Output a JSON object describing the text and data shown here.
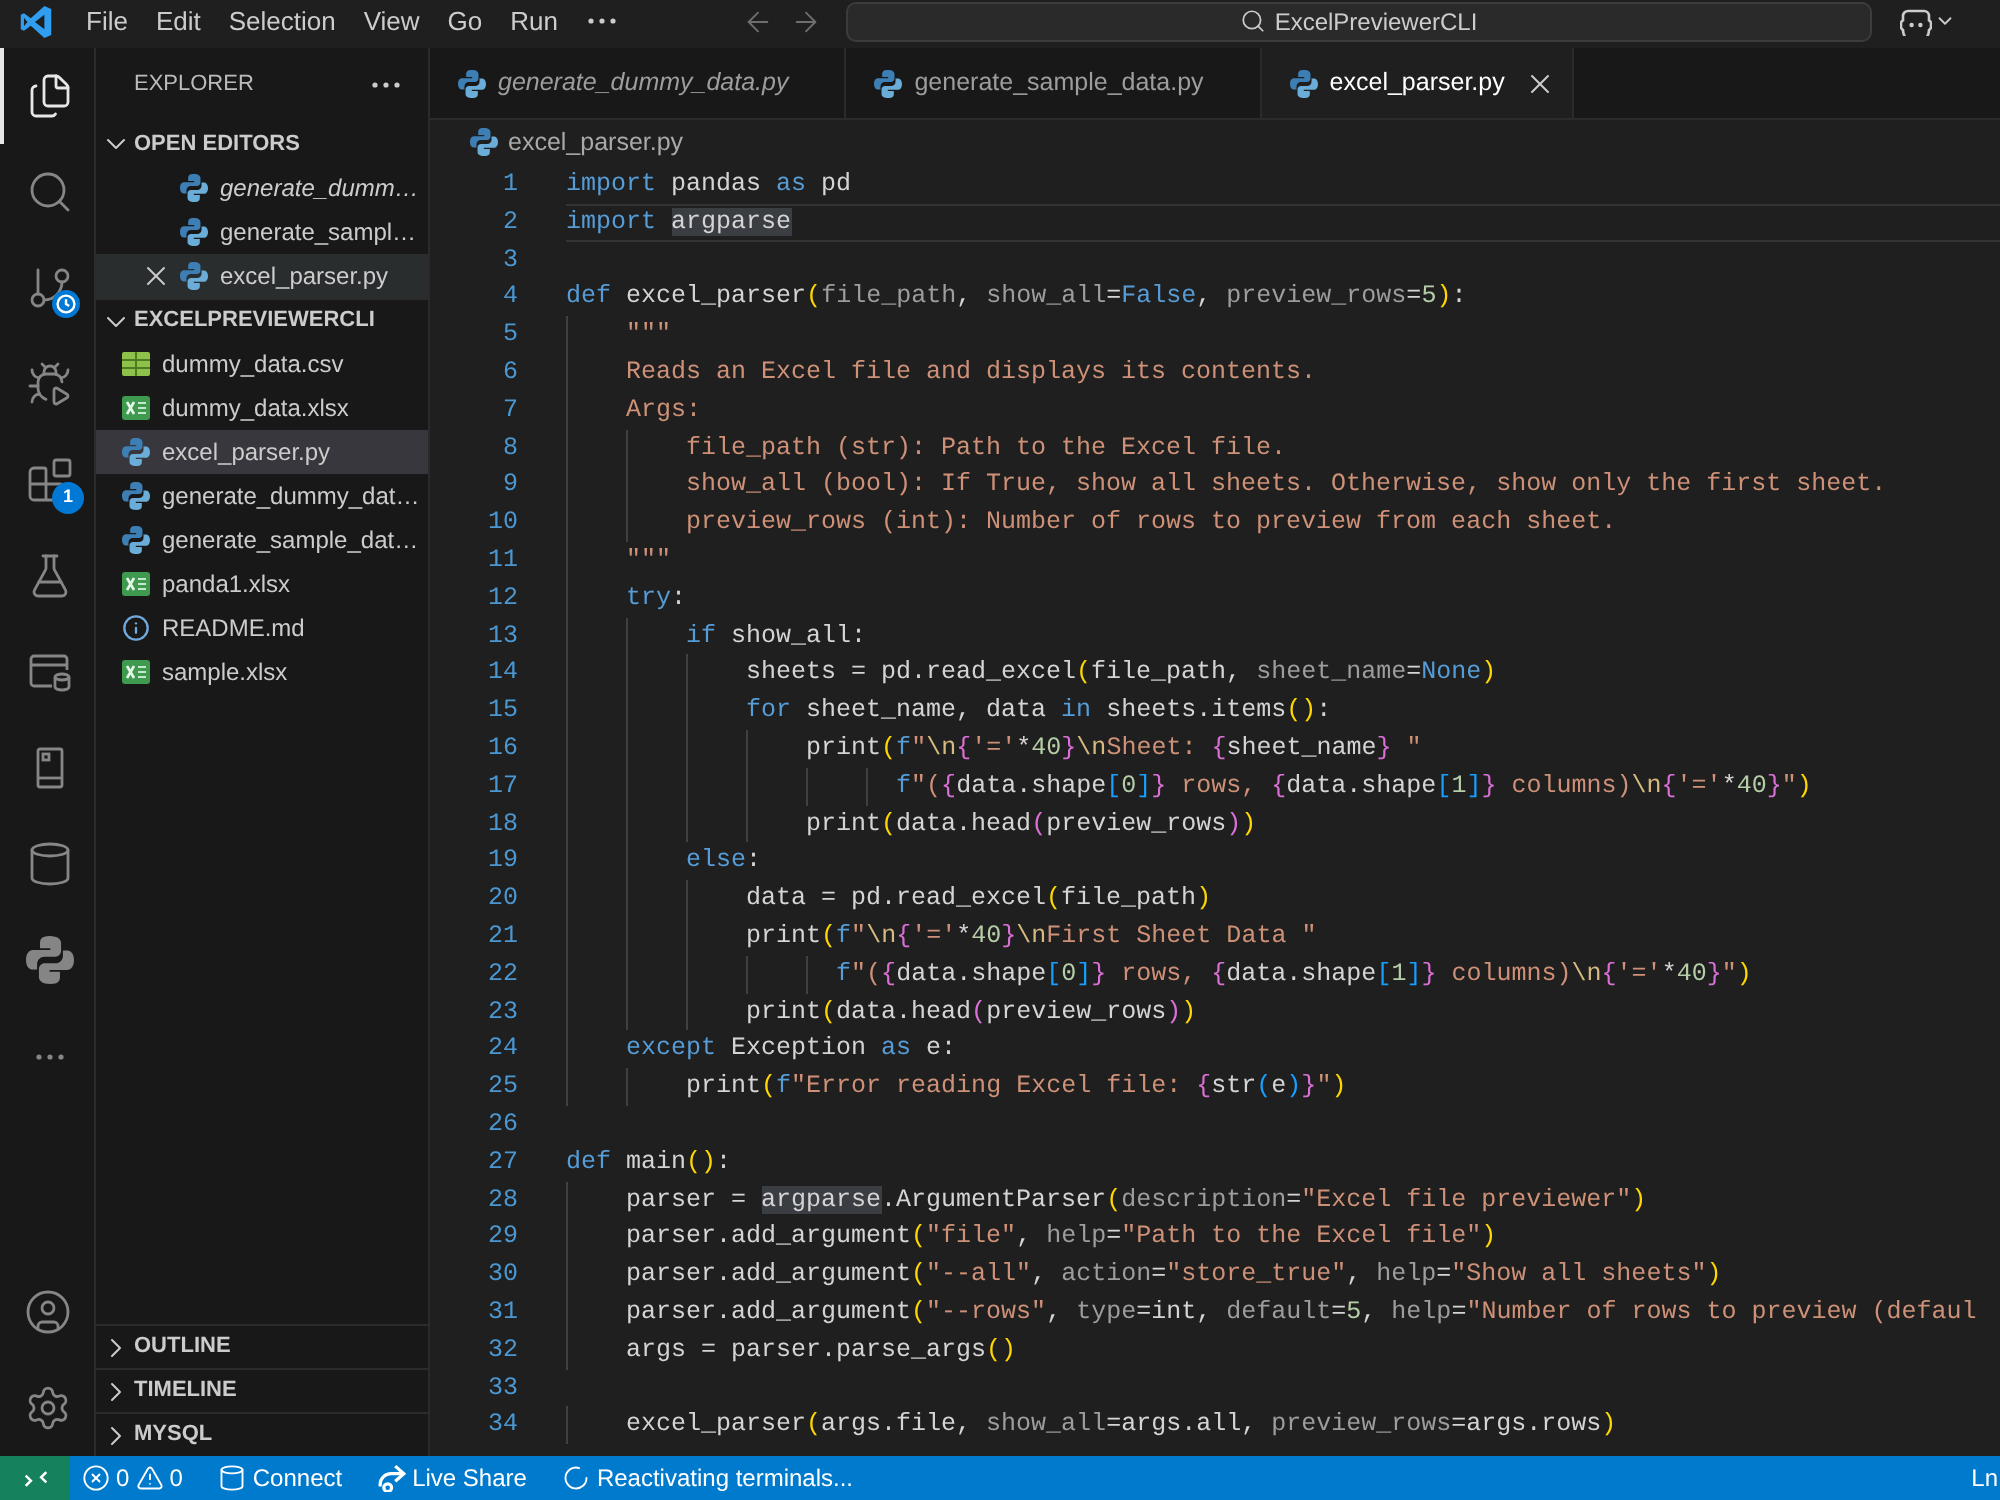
{
  "title_bar": {
    "menu": [
      "File",
      "Edit",
      "Selection",
      "View",
      "Go",
      "Run"
    ],
    "command_center": "ExcelPreviewerCLI"
  },
  "activity_bar": {
    "items": [
      {
        "kind": "explorer",
        "selected": true
      },
      {
        "kind": "search",
        "selected": false
      },
      {
        "kind": "source-control",
        "selected": false
      },
      {
        "kind": "run-debug",
        "selected": false
      },
      {
        "kind": "extensions",
        "selected": false,
        "badge": "1"
      },
      {
        "kind": "testing",
        "selected": false
      },
      {
        "kind": "remote",
        "selected": false
      },
      {
        "kind": "device",
        "selected": false
      },
      {
        "kind": "database",
        "selected": false
      },
      {
        "kind": "python",
        "selected": false
      },
      {
        "kind": "more",
        "selected": false
      }
    ],
    "bottom": [
      {
        "kind": "account"
      },
      {
        "kind": "settings"
      }
    ]
  },
  "explorer": {
    "title": "EXPLORER",
    "open_editors": {
      "label": "OPEN EDITORS",
      "expanded": true,
      "items": [
        {
          "name": "generate_dumm…",
          "preview": true,
          "selected": false
        },
        {
          "name": "generate_sampl…",
          "preview": false,
          "selected": false
        },
        {
          "name": "excel_parser.py",
          "preview": false,
          "selected": true
        }
      ]
    },
    "project": {
      "label": "EXCELPREVIEWERCLI",
      "expanded": true,
      "files": [
        {
          "name": "dummy_data.csv",
          "kind": "csv",
          "selected": false
        },
        {
          "name": "dummy_data.xlsx",
          "kind": "excel",
          "selected": false
        },
        {
          "name": "excel_parser.py",
          "kind": "python",
          "selected": true
        },
        {
          "name": "generate_dummy_dat…",
          "kind": "python",
          "selected": false
        },
        {
          "name": "generate_sample_dat…",
          "kind": "python",
          "selected": false
        },
        {
          "name": "panda1.xlsx",
          "kind": "excel",
          "selected": false
        },
        {
          "name": "README.md",
          "kind": "info",
          "selected": false
        },
        {
          "name": "sample.xlsx",
          "kind": "excel",
          "selected": false
        }
      ]
    },
    "panels": [
      {
        "label": "OUTLINE",
        "expanded": false
      },
      {
        "label": "TIMELINE",
        "expanded": false
      },
      {
        "label": "MYSQL",
        "expanded": false
      }
    ]
  },
  "tabs": [
    {
      "label": "generate_dummy_data.py",
      "preview": true,
      "selected": false
    },
    {
      "label": "generate_sample_data.py",
      "preview": false,
      "selected": false
    },
    {
      "label": "excel_parser.py",
      "preview": false,
      "selected": true
    }
  ],
  "editor": {
    "breadcrumb": "excel_parser.py",
    "lines": [
      {
        "number": "1",
        "current": false,
        "tokens": [
          {
            "text": "import",
            "kind": "keyword"
          },
          {
            "text": " pandas ",
            "kind": "name"
          },
          {
            "text": "as",
            "kind": "keyword"
          },
          {
            "text": " pd",
            "kind": "name"
          }
        ]
      },
      {
        "number": "2",
        "current": true,
        "tokens": [
          {
            "text": "import ",
            "kind": "keyword"
          },
          {
            "text": "argparse",
            "kind": "highlight"
          }
        ]
      },
      {
        "number": "3",
        "current": false
      },
      {
        "number": "4",
        "current": false,
        "tokens": [
          {
            "text": "def",
            "kind": "keyword"
          },
          {
            "text": " excel_parser",
            "kind": "name"
          },
          {
            "text": "(",
            "kind": "bracket1"
          },
          {
            "text": "file_path",
            "kind": "parameter"
          },
          {
            "text": ", ",
            "kind": "name"
          },
          {
            "text": "show_all",
            "kind": "parameter"
          },
          {
            "text": "=",
            "kind": "name"
          },
          {
            "text": "False",
            "kind": "constant"
          },
          {
            "text": ", ",
            "kind": "name"
          },
          {
            "text": "preview_rows",
            "kind": "parameter"
          },
          {
            "text": "=",
            "kind": "name"
          },
          {
            "text": "5",
            "kind": "number"
          },
          {
            "text": ")",
            "kind": "bracket1"
          },
          {
            "text": ":",
            "kind": "name"
          }
        ]
      },
      {
        "number": "5",
        "current": false,
        "tokens": [
          {
            "text": "    \"\"\"",
            "kind": "string"
          }
        ]
      },
      {
        "number": "6",
        "current": false,
        "tokens": [
          {
            "text": "    Reads an Excel file and displays its contents.",
            "kind": "string"
          }
        ]
      },
      {
        "number": "7",
        "current": false,
        "tokens": [
          {
            "text": "    Args:",
            "kind": "string"
          }
        ]
      },
      {
        "number": "8",
        "current": false,
        "tokens": [
          {
            "text": "        file_path (str): Path to the Excel file.",
            "kind": "string"
          }
        ]
      },
      {
        "number": "9",
        "current": false,
        "tokens": [
          {
            "text": "        show_all (bool): If True, show all sheets. Otherwise, show only the first sheet.",
            "kind": "string"
          }
        ]
      },
      {
        "number": "10",
        "current": false,
        "tokens": [
          {
            "text": "        preview_rows (int): Number of rows to preview from each sheet.",
            "kind": "string"
          }
        ]
      },
      {
        "number": "11",
        "current": false,
        "tokens": [
          {
            "text": "    \"\"\"",
            "kind": "string"
          }
        ]
      },
      {
        "number": "12",
        "current": false,
        "tokens": [
          {
            "text": "    try",
            "kind": "keyword"
          },
          {
            "text": ":",
            "kind": "name"
          }
        ]
      },
      {
        "number": "13",
        "current": false,
        "tokens": [
          {
            "text": "        if",
            "kind": "keyword"
          },
          {
            "text": " show_all:",
            "kind": "name"
          }
        ]
      },
      {
        "number": "14",
        "current": false,
        "tokens": [
          {
            "text": "            sheets = pd.read_excel",
            "kind": "name"
          },
          {
            "text": "(",
            "kind": "bracket1"
          },
          {
            "text": "file_path, ",
            "kind": "name"
          },
          {
            "text": "sheet_name",
            "kind": "parameter"
          },
          {
            "text": "=",
            "kind": "name"
          },
          {
            "text": "None",
            "kind": "constant"
          },
          {
            "text": ")",
            "kind": "bracket1"
          }
        ]
      },
      {
        "number": "15",
        "current": false,
        "tokens": [
          {
            "text": "            for",
            "kind": "keyword"
          },
          {
            "text": " sheet_name, data ",
            "kind": "name"
          },
          {
            "text": "in",
            "kind": "keyword"
          },
          {
            "text": " sheets.items",
            "kind": "name"
          },
          {
            "text": "()",
            "kind": "bracket1"
          },
          {
            "text": ":",
            "kind": "name"
          }
        ]
      },
      {
        "number": "16",
        "current": false,
        "tokens": [
          {
            "text": "                print",
            "kind": "name"
          },
          {
            "text": "(",
            "kind": "bracket1"
          },
          {
            "text": "f",
            "kind": "keyword"
          },
          {
            "text": "\"",
            "kind": "string"
          },
          {
            "text": "\\n",
            "kind": "escape"
          },
          {
            "text": "{",
            "kind": "bracket2"
          },
          {
            "text": "'='",
            "kind": "string"
          },
          {
            "text": "*",
            "kind": "name"
          },
          {
            "text": "40",
            "kind": "number"
          },
          {
            "text": "}",
            "kind": "bracket2"
          },
          {
            "text": "\\n",
            "kind": "escape"
          },
          {
            "text": "Sheet: ",
            "kind": "string"
          },
          {
            "text": "{",
            "kind": "bracket2"
          },
          {
            "text": "sheet_name",
            "kind": "name"
          },
          {
            "text": "}",
            "kind": "bracket2"
          },
          {
            "text": " \"",
            "kind": "string"
          }
        ]
      },
      {
        "number": "17",
        "current": false,
        "tokens": [
          {
            "text": "                      f",
            "kind": "keyword"
          },
          {
            "text": "\"(",
            "kind": "string"
          },
          {
            "text": "{",
            "kind": "bracket2"
          },
          {
            "text": "data.shape",
            "kind": "name"
          },
          {
            "text": "[",
            "kind": "bracket3"
          },
          {
            "text": "0",
            "kind": "number"
          },
          {
            "text": "]",
            "kind": "bracket3"
          },
          {
            "text": "}",
            "kind": "bracket2"
          },
          {
            "text": " rows, ",
            "kind": "string"
          },
          {
            "text": "{",
            "kind": "bracket2"
          },
          {
            "text": "data.shape",
            "kind": "name"
          },
          {
            "text": "[",
            "kind": "bracket3"
          },
          {
            "text": "1",
            "kind": "number"
          },
          {
            "text": "]",
            "kind": "bracket3"
          },
          {
            "text": "}",
            "kind": "bracket2"
          },
          {
            "text": " columns)",
            "kind": "string"
          },
          {
            "text": "\\n",
            "kind": "escape"
          },
          {
            "text": "{",
            "kind": "bracket2"
          },
          {
            "text": "'='",
            "kind": "string"
          },
          {
            "text": "*",
            "kind": "name"
          },
          {
            "text": "40",
            "kind": "number"
          },
          {
            "text": "}",
            "kind": "bracket2"
          },
          {
            "text": "\"",
            "kind": "string"
          },
          {
            "text": ")",
            "kind": "bracket1"
          }
        ]
      },
      {
        "number": "18",
        "current": false,
        "tokens": [
          {
            "text": "                print",
            "kind": "name"
          },
          {
            "text": "(",
            "kind": "bracket1"
          },
          {
            "text": "data.head",
            "kind": "name"
          },
          {
            "text": "(",
            "kind": "bracket2"
          },
          {
            "text": "preview_rows",
            "kind": "name"
          },
          {
            "text": ")",
            "kind": "bracket2"
          },
          {
            "text": ")",
            "kind": "bracket1"
          }
        ]
      },
      {
        "number": "19",
        "current": false,
        "tokens": [
          {
            "text": "        else",
            "kind": "keyword"
          },
          {
            "text": ":",
            "kind": "name"
          }
        ]
      },
      {
        "number": "20",
        "current": false,
        "tokens": [
          {
            "text": "            data = pd.read_excel",
            "kind": "name"
          },
          {
            "text": "(",
            "kind": "bracket1"
          },
          {
            "text": "file_path",
            "kind": "name"
          },
          {
            "text": ")",
            "kind": "bracket1"
          }
        ]
      },
      {
        "number": "21",
        "current": false,
        "tokens": [
          {
            "text": "            print",
            "kind": "name"
          },
          {
            "text": "(",
            "kind": "bracket1"
          },
          {
            "text": "f",
            "kind": "keyword"
          },
          {
            "text": "\"",
            "kind": "string"
          },
          {
            "text": "\\n",
            "kind": "escape"
          },
          {
            "text": "{",
            "kind": "bracket2"
          },
          {
            "text": "'='",
            "kind": "string"
          },
          {
            "text": "*",
            "kind": "name"
          },
          {
            "text": "40",
            "kind": "number"
          },
          {
            "text": "}",
            "kind": "bracket2"
          },
          {
            "text": "\\n",
            "kind": "escape"
          },
          {
            "text": "First Sheet Data \"",
            "kind": "string"
          }
        ]
      },
      {
        "number": "22",
        "current": false,
        "tokens": [
          {
            "text": "                  f",
            "kind": "keyword"
          },
          {
            "text": "\"(",
            "kind": "string"
          },
          {
            "text": "{",
            "kind": "bracket2"
          },
          {
            "text": "data.shape",
            "kind": "name"
          },
          {
            "text": "[",
            "kind": "bracket3"
          },
          {
            "text": "0",
            "kind": "number"
          },
          {
            "text": "]",
            "kind": "bracket3"
          },
          {
            "text": "}",
            "kind": "bracket2"
          },
          {
            "text": " rows, ",
            "kind": "string"
          },
          {
            "text": "{",
            "kind": "bracket2"
          },
          {
            "text": "data.shape",
            "kind": "name"
          },
          {
            "text": "[",
            "kind": "bracket3"
          },
          {
            "text": "1",
            "kind": "number"
          },
          {
            "text": "]",
            "kind": "bracket3"
          },
          {
            "text": "}",
            "kind": "bracket2"
          },
          {
            "text": " columns)",
            "kind": "string"
          },
          {
            "text": "\\n",
            "kind": "escape"
          },
          {
            "text": "{",
            "kind": "bracket2"
          },
          {
            "text": "'='",
            "kind": "string"
          },
          {
            "text": "*",
            "kind": "name"
          },
          {
            "text": "40",
            "kind": "number"
          },
          {
            "text": "}",
            "kind": "bracket2"
          },
          {
            "text": "\"",
            "kind": "string"
          },
          {
            "text": ")",
            "kind": "bracket1"
          }
        ]
      },
      {
        "number": "23",
        "current": false,
        "tokens": [
          {
            "text": "            print",
            "kind": "name"
          },
          {
            "text": "(",
            "kind": "bracket1"
          },
          {
            "text": "data.head",
            "kind": "name"
          },
          {
            "text": "(",
            "kind": "bracket2"
          },
          {
            "text": "preview_rows",
            "kind": "name"
          },
          {
            "text": ")",
            "kind": "bracket2"
          },
          {
            "text": ")",
            "kind": "bracket1"
          }
        ]
      },
      {
        "number": "24",
        "current": false,
        "tokens": [
          {
            "text": "    except",
            "kind": "keyword"
          },
          {
            "text": " Exception ",
            "kind": "name"
          },
          {
            "text": "as",
            "kind": "keyword"
          },
          {
            "text": " e:",
            "kind": "name"
          }
        ]
      },
      {
        "number": "25",
        "current": false,
        "tokens": [
          {
            "text": "        print",
            "kind": "name"
          },
          {
            "text": "(",
            "kind": "bracket1"
          },
          {
            "text": "f",
            "kind": "keyword"
          },
          {
            "text": "\"Error reading Excel file: ",
            "kind": "string"
          },
          {
            "text": "{",
            "kind": "bracket2"
          },
          {
            "text": "str",
            "kind": "name"
          },
          {
            "text": "(",
            "kind": "bracket3"
          },
          {
            "text": "e",
            "kind": "name"
          },
          {
            "text": ")",
            "kind": "bracket3"
          },
          {
            "text": "}",
            "kind": "bracket2"
          },
          {
            "text": "\"",
            "kind": "string"
          },
          {
            "text": ")",
            "kind": "bracket1"
          }
        ]
      },
      {
        "number": "26",
        "current": false
      },
      {
        "number": "27",
        "current": false,
        "tokens": [
          {
            "text": "def",
            "kind": "keyword"
          },
          {
            "text": " main",
            "kind": "name"
          },
          {
            "text": "()",
            "kind": "bracket1"
          },
          {
            "text": ":",
            "kind": "name"
          }
        ]
      },
      {
        "number": "28",
        "current": false,
        "tokens": [
          {
            "text": "    parser = ",
            "kind": "name"
          },
          {
            "text": "argparse",
            "kind": "highlight"
          },
          {
            "text": ".ArgumentParser",
            "kind": "name"
          },
          {
            "text": "(",
            "kind": "bracket1"
          },
          {
            "text": "description",
            "kind": "parameter"
          },
          {
            "text": "=",
            "kind": "name"
          },
          {
            "text": "\"Excel file previewer\"",
            "kind": "string"
          },
          {
            "text": ")",
            "kind": "bracket1"
          }
        ]
      },
      {
        "number": "29",
        "current": false,
        "tokens": [
          {
            "text": "    parser.add_argument",
            "kind": "name"
          },
          {
            "text": "(",
            "kind": "bracket1"
          },
          {
            "text": "\"file\"",
            "kind": "string"
          },
          {
            "text": ", ",
            "kind": "name"
          },
          {
            "text": "help",
            "kind": "parameter"
          },
          {
            "text": "=",
            "kind": "name"
          },
          {
            "text": "\"Path to the Excel file\"",
            "kind": "string"
          },
          {
            "text": ")",
            "kind": "bracket1"
          }
        ]
      },
      {
        "number": "30",
        "current": false,
        "tokens": [
          {
            "text": "    parser.add_argument",
            "kind": "name"
          },
          {
            "text": "(",
            "kind": "bracket1"
          },
          {
            "text": "\"--all\"",
            "kind": "string"
          },
          {
            "text": ", ",
            "kind": "name"
          },
          {
            "text": "action",
            "kind": "parameter"
          },
          {
            "text": "=",
            "kind": "name"
          },
          {
            "text": "\"store_true\"",
            "kind": "string"
          },
          {
            "text": ", ",
            "kind": "name"
          },
          {
            "text": "help",
            "kind": "parameter"
          },
          {
            "text": "=",
            "kind": "name"
          },
          {
            "text": "\"Show all sheets\"",
            "kind": "string"
          },
          {
            "text": ")",
            "kind": "bracket1"
          }
        ]
      },
      {
        "number": "31",
        "current": false,
        "tokens": [
          {
            "text": "    parser.add_argument",
            "kind": "name"
          },
          {
            "text": "(",
            "kind": "bracket1"
          },
          {
            "text": "\"--rows\"",
            "kind": "string"
          },
          {
            "text": ", ",
            "kind": "name"
          },
          {
            "text": "type",
            "kind": "parameter"
          },
          {
            "text": "=int, ",
            "kind": "name"
          },
          {
            "text": "default",
            "kind": "parameter"
          },
          {
            "text": "=",
            "kind": "name"
          },
          {
            "text": "5",
            "kind": "number"
          },
          {
            "text": ", ",
            "kind": "name"
          },
          {
            "text": "help",
            "kind": "parameter"
          },
          {
            "text": "=",
            "kind": "name"
          },
          {
            "text": "\"Number of rows to preview (defaul",
            "kind": "string"
          }
        ]
      },
      {
        "number": "32",
        "current": false,
        "tokens": [
          {
            "text": "    args = parser.parse_args",
            "kind": "name"
          },
          {
            "text": "()",
            "kind": "bracket1"
          }
        ]
      },
      {
        "number": "33",
        "current": false
      },
      {
        "number": "34",
        "current": false,
        "tokens": [
          {
            "text": "    excel_parser",
            "kind": "name"
          },
          {
            "text": "(",
            "kind": "bracket1"
          },
          {
            "text": "args.file, ",
            "kind": "name"
          },
          {
            "text": "show_all",
            "kind": "parameter"
          },
          {
            "text": "=args.all, ",
            "kind": "name"
          },
          {
            "text": "preview_rows",
            "kind": "parameter"
          },
          {
            "text": "=args.rows",
            "kind": "name"
          },
          {
            "text": ")",
            "kind": "bracket1"
          }
        ]
      }
    ]
  },
  "status_bar": {
    "items": [
      {
        "kind": "errors",
        "label": "0"
      },
      {
        "kind": "warnings",
        "label": "0"
      },
      {
        "kind": "connect",
        "label": "Connect"
      },
      {
        "kind": "live-share",
        "label": "Live Share"
      },
      {
        "kind": "progress",
        "label": "Reactivating terminals..."
      },
      {
        "kind": "position",
        "label": "Ln"
      }
    ]
  }
}
